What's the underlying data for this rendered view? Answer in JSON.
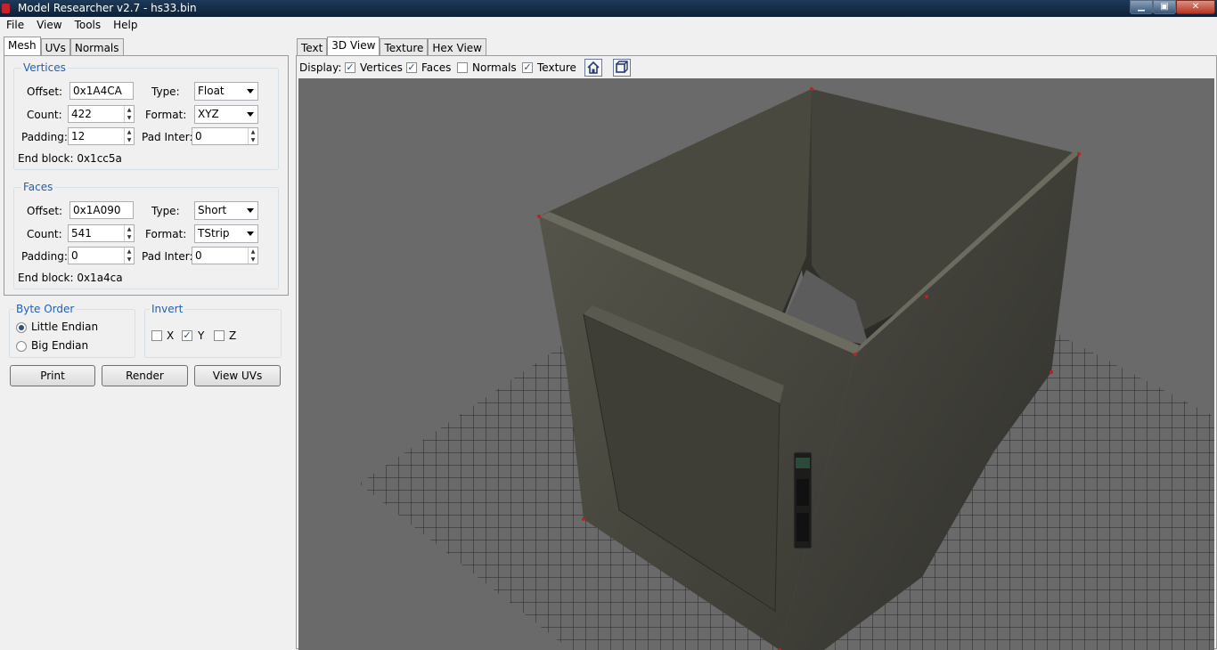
{
  "window": {
    "title": "Model Researcher v2.7 - hs33.bin"
  },
  "menu": [
    "File",
    "View",
    "Tools",
    "Help"
  ],
  "left_tabs": [
    "Mesh",
    "UVs",
    "Normals"
  ],
  "vertices": {
    "title": "Vertices",
    "offset_label": "Offset:",
    "offset": "0x1A4CA",
    "type_label": "Type:",
    "type": "Float",
    "count_label": "Count:",
    "count": "422",
    "format_label": "Format:",
    "format": "XYZ",
    "padding_label": "Padding:",
    "padding": "12",
    "padinter_label": "Pad Inter:",
    "padinter": "0",
    "endblock": "End block: 0x1cc5a"
  },
  "faces": {
    "title": "Faces",
    "offset_label": "Offset:",
    "offset": "0x1A090",
    "type_label": "Type:",
    "type": "Short",
    "count_label": "Count:",
    "count": "541",
    "format_label": "Format:",
    "format": "TStrip",
    "padding_label": "Padding:",
    "padding": "0",
    "padinter_label": "Pad Inter:",
    "padinter": "0",
    "endblock": "End block: 0x1a4ca"
  },
  "byte_order": {
    "title": "Byte Order",
    "little": "Little Endian",
    "big": "Big Endian",
    "selected": "Little Endian"
  },
  "invert": {
    "title": "Invert",
    "x": "X",
    "y": "Y",
    "z": "Z",
    "x_checked": false,
    "y_checked": true,
    "z_checked": false
  },
  "buttons": {
    "print": "Print",
    "render": "Render",
    "view_uvs": "View UVs"
  },
  "right_tabs": [
    "Text",
    "3D View",
    "Texture",
    "Hex View"
  ],
  "display": {
    "label": "Display:",
    "vertices": "Vertices",
    "faces": "Faces",
    "normals": "Normals",
    "texture": "Texture",
    "vertices_checked": true,
    "faces_checked": true,
    "normals_checked": false,
    "texture_checked": true
  },
  "icons": [
    "home-icon",
    "reset-view-icon"
  ]
}
